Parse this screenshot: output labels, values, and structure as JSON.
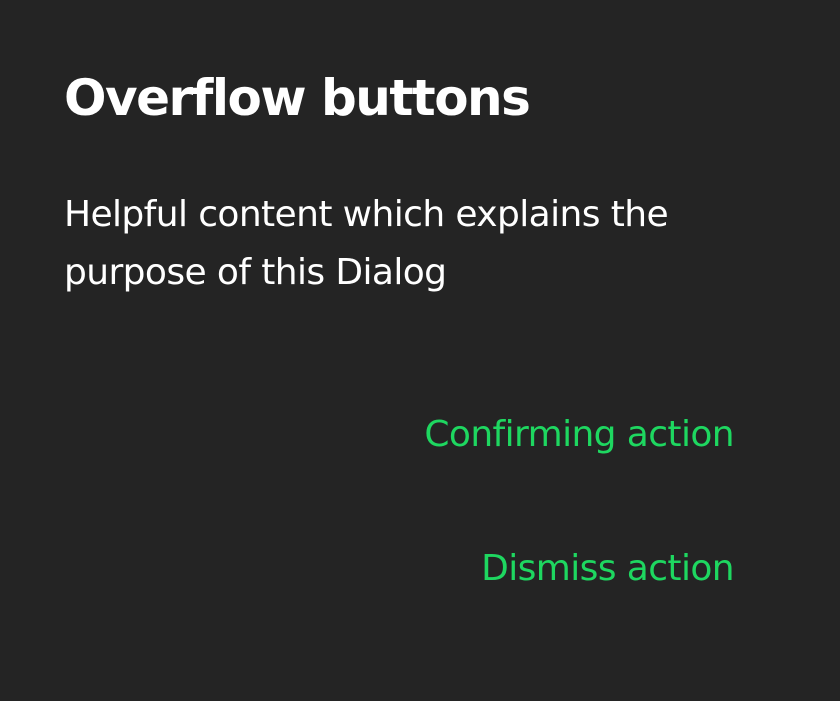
{
  "dialog": {
    "title": "Overflow buttons",
    "content": "Helpful content which explains the purpose of this Dialog",
    "actions": {
      "confirm_label": "Confirming action",
      "dismiss_label": "Dismiss action"
    }
  },
  "colors": {
    "background": "#242424",
    "text": "#ffffff",
    "action": "#1ed760"
  }
}
